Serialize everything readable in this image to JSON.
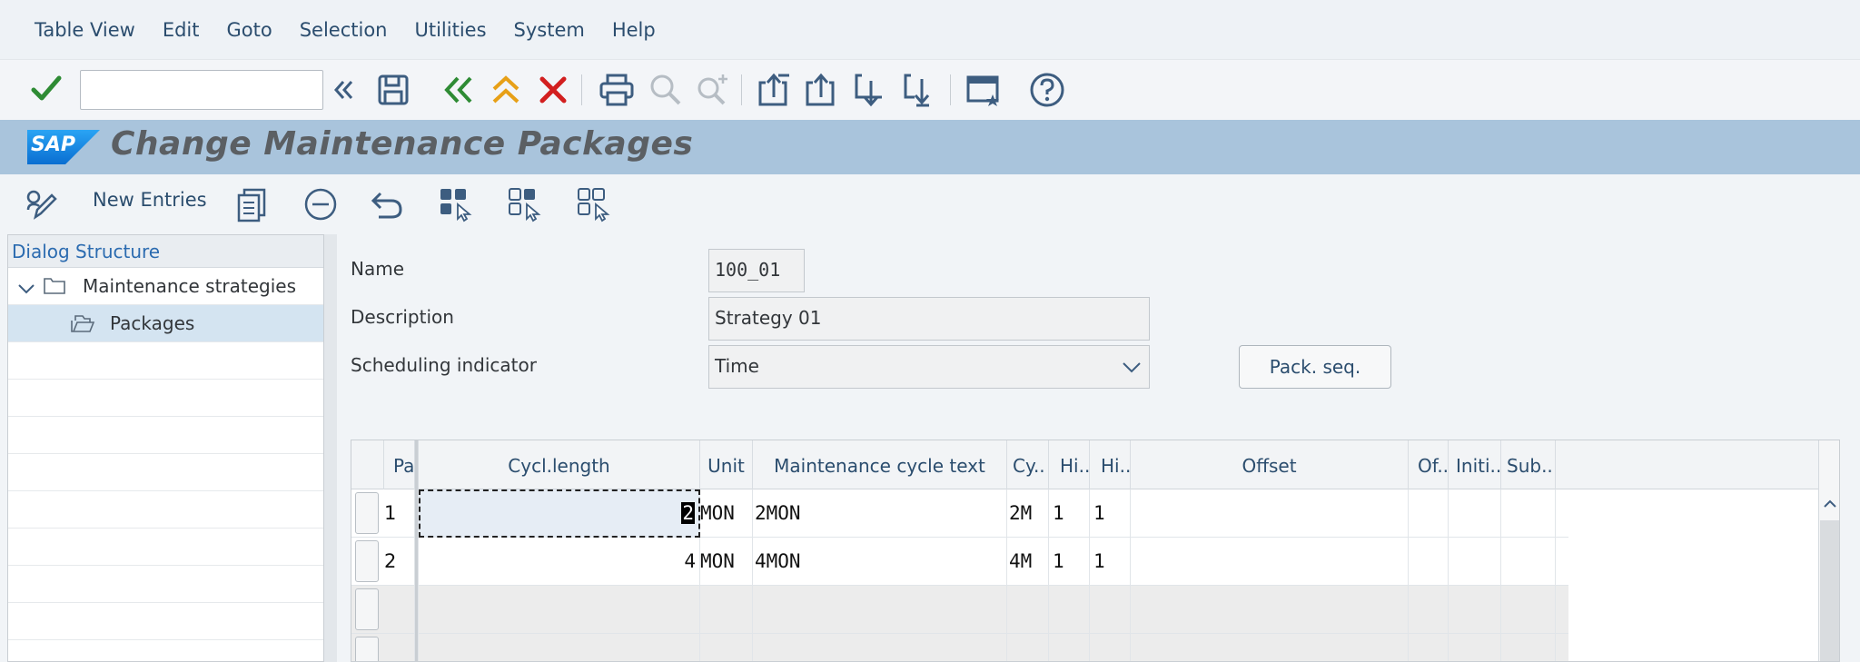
{
  "menu": [
    "Table View",
    "Edit",
    "Goto",
    "Selection",
    "Utilities",
    "System",
    "Help"
  ],
  "toolbar": {
    "command_value": "",
    "icons": [
      "checkmark-icon",
      "double-chevron-left-icon",
      "save-icon",
      "back-icon",
      "exit-icon",
      "cancel-icon",
      "print-icon",
      "find-icon",
      "find-next-icon",
      "first-page-icon",
      "previous-page-icon",
      "next-page-icon",
      "last-page-icon",
      "new-window-icon",
      "help-icon"
    ]
  },
  "title": {
    "logo": "SAP",
    "text": "Change Maintenance Packages"
  },
  "app_toolbar": {
    "new_entries": "New Entries",
    "icons": [
      "display-change-icon",
      "copy-icon",
      "delete-icon",
      "undo-icon",
      "select-all-icon",
      "select-block-icon",
      "deselect-all-icon"
    ]
  },
  "dialog_structure": {
    "header": "Dialog Structure",
    "items": [
      {
        "label": "Maintenance strategies",
        "icon": "folder-icon",
        "expanded": true
      },
      {
        "label": "Packages",
        "icon": "open-folder-icon",
        "selected": true
      }
    ]
  },
  "form": {
    "name_label": "Name",
    "name_value": "100_01",
    "description_label": "Description",
    "description_value": "Strategy 01",
    "scheduling_label": "Scheduling indicator",
    "scheduling_value": "Time",
    "pack_seq_button": "Pack. seq."
  },
  "table": {
    "headers": [
      "Pa..",
      "Cycl.length",
      "Unit",
      "Maintenance cycle text",
      "Cy..",
      "Hi..",
      "Hi..",
      "Offset",
      "Of..",
      "Initi..",
      "Sub.."
    ],
    "rows": [
      {
        "pa": "1",
        "cycle": "2",
        "unit": "MON",
        "text": "2MON",
        "cy": "2M",
        "hi1": "1",
        "hi2": "1"
      },
      {
        "pa": "2",
        "cycle": "4",
        "unit": "MON",
        "text": "4MON",
        "cy": "4M",
        "hi1": "1",
        "hi2": "1"
      }
    ]
  },
  "colors": {
    "accent": "#2b4d6e",
    "title_bar": "#a9c4dc",
    "sap_blue": "#1a7ed0",
    "ok_green": "#2e8b34",
    "cancel_red": "#d21f1f",
    "exit_orange": "#e7a017"
  }
}
